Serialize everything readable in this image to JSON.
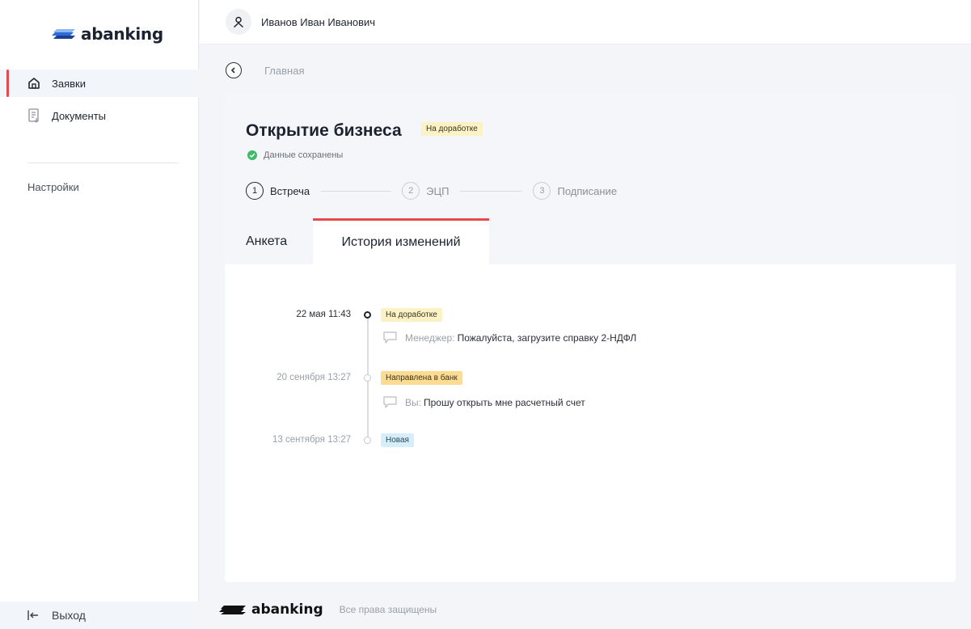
{
  "brand": {
    "name": "abanking",
    "logo_icon": "stacked-stripes-logo-icon",
    "accent_color": "#e8494d",
    "logo_color": "#2f6bd6"
  },
  "sidebar": {
    "items": [
      {
        "label": "Заявки",
        "icon": "home-icon",
        "active": true
      },
      {
        "label": "Документы",
        "icon": "document-icon",
        "active": false
      }
    ],
    "settings_label": "Настройки",
    "logout_label": "Выход"
  },
  "header": {
    "user_name": "Иванов Иван Иванович",
    "avatar_icon": "user-icon"
  },
  "breadcrumb": {
    "current": "Главная"
  },
  "application": {
    "title": "Открытие бизнеса",
    "status": "На доработке",
    "saved_text": "Данные сохранены",
    "steps": [
      {
        "num": "1",
        "label": "Встреча",
        "active": true
      },
      {
        "num": "2",
        "label": "ЭЦП",
        "active": false
      },
      {
        "num": "3",
        "label": "Подписание",
        "active": false
      }
    ],
    "tabs": [
      {
        "label": "Анкета",
        "active": false
      },
      {
        "label": "История изменений",
        "active": true
      }
    ]
  },
  "history": [
    {
      "date": "22 мая 11:43",
      "status": "На доработке",
      "status_color": "#fbf3c6",
      "comment_author": "Менеджер:",
      "comment_text": "Пожалуйста, загрузите справку 2-НДФЛ"
    },
    {
      "date": "20 сенября 13:27",
      "status": "Направлена в банк",
      "status_color": "#fbdc91",
      "comment_author": "Вы:",
      "comment_text": "Прошу открыть мне расчетный счет"
    },
    {
      "date": "13 сентября 13:27",
      "status": "Новая",
      "status_color": "#d6eef8"
    }
  ],
  "footer": {
    "brand": "abanking",
    "copyright": "Все права защищены"
  }
}
